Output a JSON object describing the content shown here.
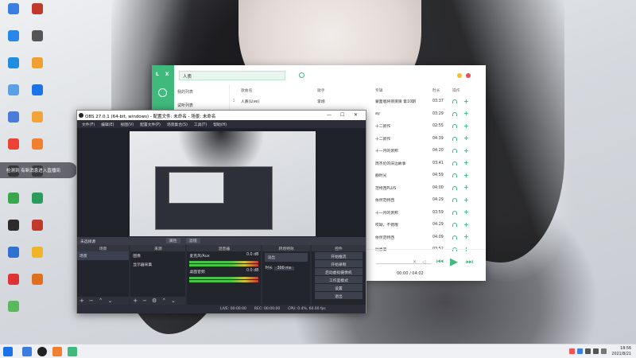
{
  "desktop": {
    "notice": "检测到 有新消息进入直播间",
    "icons": [
      {
        "label": "",
        "color": "#3b7de0"
      },
      {
        "label": "",
        "color": "#2a86e8"
      },
      {
        "label": "",
        "color": "#1f8ee0"
      },
      {
        "label": "",
        "color": "#5aa0e6"
      },
      {
        "label": "",
        "color": "#4b7bd8"
      },
      {
        "label": "",
        "color": "#ea4335"
      },
      {
        "label": "",
        "color": "#222222"
      },
      {
        "label": "",
        "color": "#3aa64b"
      },
      {
        "label": "",
        "color": "#2c2c2c"
      },
      {
        "label": "",
        "color": "#3070d0"
      },
      {
        "label": "",
        "color": "#d33"
      },
      {
        "label": "",
        "color": "#5cb85c"
      }
    ],
    "icons2": [
      {
        "label": "",
        "color": "#c0392b"
      },
      {
        "label": "",
        "color": "#555555"
      },
      {
        "label": "",
        "color": "#f0a030"
      },
      {
        "label": "",
        "color": "#1a73e8"
      },
      {
        "label": "",
        "color": "#f2a33a"
      },
      {
        "label": "",
        "color": "#f08030"
      },
      {
        "label": "",
        "color": "#333"
      },
      {
        "label": "",
        "color": "#2a9d5c"
      },
      {
        "label": "",
        "color": "#c0392b"
      },
      {
        "label": "",
        "color": "#f0b429"
      },
      {
        "label": "",
        "color": "#e07020"
      }
    ]
  },
  "music": {
    "logo": "L X",
    "search_value": "人质",
    "accent": "#3fb97c",
    "my_list_header": "我的列表",
    "playlist_item": "试听列表",
    "columns": {
      "name": "歌曲名",
      "singer": "歌手",
      "album": "专辑",
      "duration": "时长",
      "op": "操作"
    },
    "rows": [
      {
        "idx": "1",
        "name": "人质(Live)",
        "singer": "李翊",
        "album": "蒙面唱将猜猜猜 第10期",
        "dur": "03:37"
      },
      {
        "idx": "",
        "name": "",
        "singer": "",
        "album": "ay",
        "dur": "03:29"
      },
      {
        "idx": "",
        "name": "",
        "singer": "",
        "album": "十二新作",
        "dur": "02:55"
      },
      {
        "idx": "",
        "name": "",
        "singer": "",
        "album": "十二新作",
        "dur": "04:39"
      },
      {
        "idx": "",
        "name": "",
        "singer": "",
        "album": "十一月的萧邦",
        "dur": "04:20"
      },
      {
        "idx": "",
        "name": "",
        "singer": "",
        "album": "周杰伦的床边故事",
        "dur": "03:41"
      },
      {
        "idx": "",
        "name": "",
        "singer": "",
        "album": "静时光",
        "dur": "04:59"
      },
      {
        "idx": "",
        "name": "",
        "singer": "",
        "album": "范特西PLUS",
        "dur": "04:00"
      },
      {
        "idx": "",
        "name": "",
        "singer": "",
        "album": "依然范特西",
        "dur": "04:29"
      },
      {
        "idx": "",
        "name": "",
        "singer": "",
        "album": "十一月的萧邦",
        "dur": "03:59"
      },
      {
        "idx": "",
        "name": "",
        "singer": "",
        "album": "哎呦，不错哦",
        "dur": "04:29"
      },
      {
        "idx": "",
        "name": "",
        "singer": "",
        "album": "依然范特西",
        "dur": "04:09"
      },
      {
        "idx": "",
        "name": "",
        "singer": "",
        "album": "叶惠美",
        "dur": "03:52"
      }
    ],
    "time": "00:00 / 04:02"
  },
  "obs": {
    "title": "OBS 27.0.1 (64-bit, windows) - 配置文件: 未命名 - 场景: 未命名",
    "menu": [
      "文件(F)",
      "编辑(E)",
      "视图(V)",
      "配置文件(P)",
      "场景集合(S)",
      "工具(T)",
      "帮助(H)"
    ],
    "preview_bar": "未选择源",
    "props_button": "属性",
    "filter_button": "滤镜",
    "docks": {
      "scenes": "场景",
      "sources": "来源",
      "mixer": "混音器",
      "transitions": "转场特效",
      "controls": "控件"
    },
    "scene_item": "场景",
    "source_items": [
      "图像",
      "显示器采集"
    ],
    "mixer_items": [
      {
        "name": "麦克风/Aux",
        "db": "0.0 dB"
      },
      {
        "name": "桌面音频",
        "db": "0.0 dB"
      }
    ],
    "transition_value": "淡出",
    "duration_label": "时长",
    "duration_value": "300 ms",
    "controls": [
      "开始推流",
      "开始录制",
      "启动虚拟摄像机",
      "工作室模式",
      "设置",
      "退出"
    ],
    "status": {
      "live": "LIVE: 00:00:00",
      "rec": "REC: 00:00:00",
      "cpu": "CPU: 0.4%, 60.00 fps"
    }
  },
  "taskbar": {
    "time": "18:56",
    "date": "2021/8/21"
  }
}
